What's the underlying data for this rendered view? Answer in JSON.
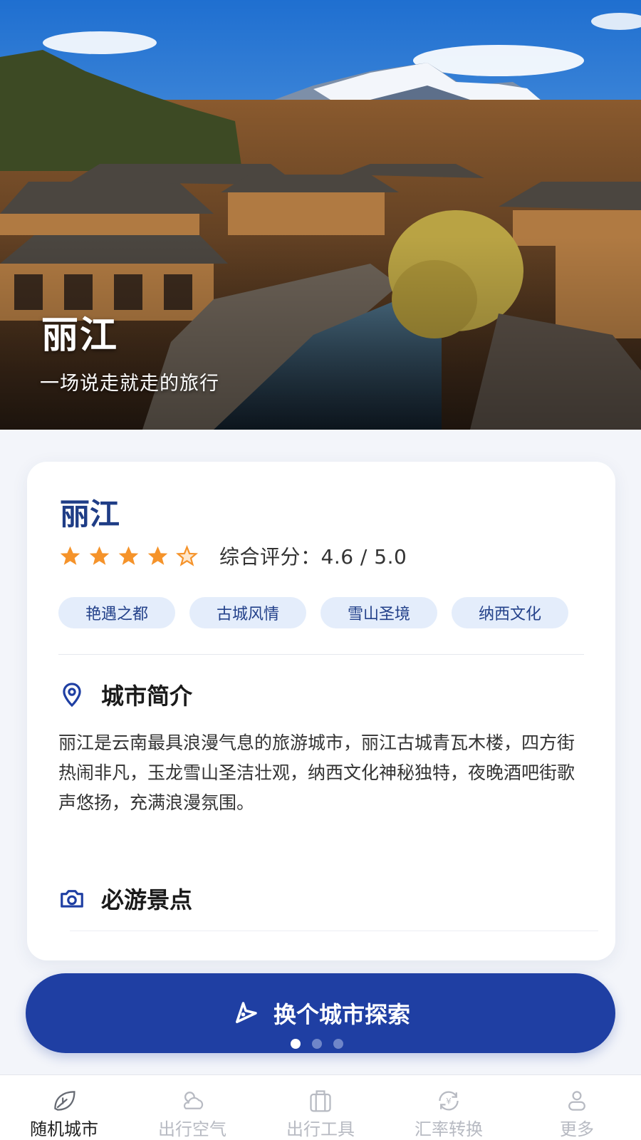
{
  "hero": {
    "title": "丽江",
    "subtitle": "一场说走就走的旅行"
  },
  "city": {
    "name": "丽江",
    "rating": 4.6,
    "rating_max": 5,
    "rating_text": "综合评分：4.6 / 5.0",
    "tags": [
      "艳遇之都",
      "古城风情",
      "雪山圣境",
      "纳西文化"
    ],
    "intro_title": "城市简介",
    "intro_text": "丽江是云南最具浪漫气息的旅游城市，丽江古城青瓦木楼，四方街热闹非凡，玉龙雪山圣洁壮观，纳西文化神秘独特，夜晚酒吧街歌声悠扬，充满浪漫氛围。",
    "sights_title": "必游景点"
  },
  "actions": {
    "explore_label": "换个城市探索"
  },
  "pager": {
    "count": 3,
    "active": 0
  },
  "nav": {
    "items": [
      {
        "label": "随机城市",
        "icon": "leaf-icon",
        "active": true
      },
      {
        "label": "出行空气",
        "icon": "weather-icon",
        "active": false
      },
      {
        "label": "出行工具",
        "icon": "suitcase-icon",
        "active": false
      },
      {
        "label": "汇率转换",
        "icon": "currency-exchange-icon",
        "active": false
      },
      {
        "label": "更多",
        "icon": "user-icon",
        "active": false
      }
    ]
  },
  "colors": {
    "primary": "#1f3fa3",
    "title": "#1f3d86",
    "star": "#f5932a",
    "tag_bg": "#e4edfb"
  }
}
